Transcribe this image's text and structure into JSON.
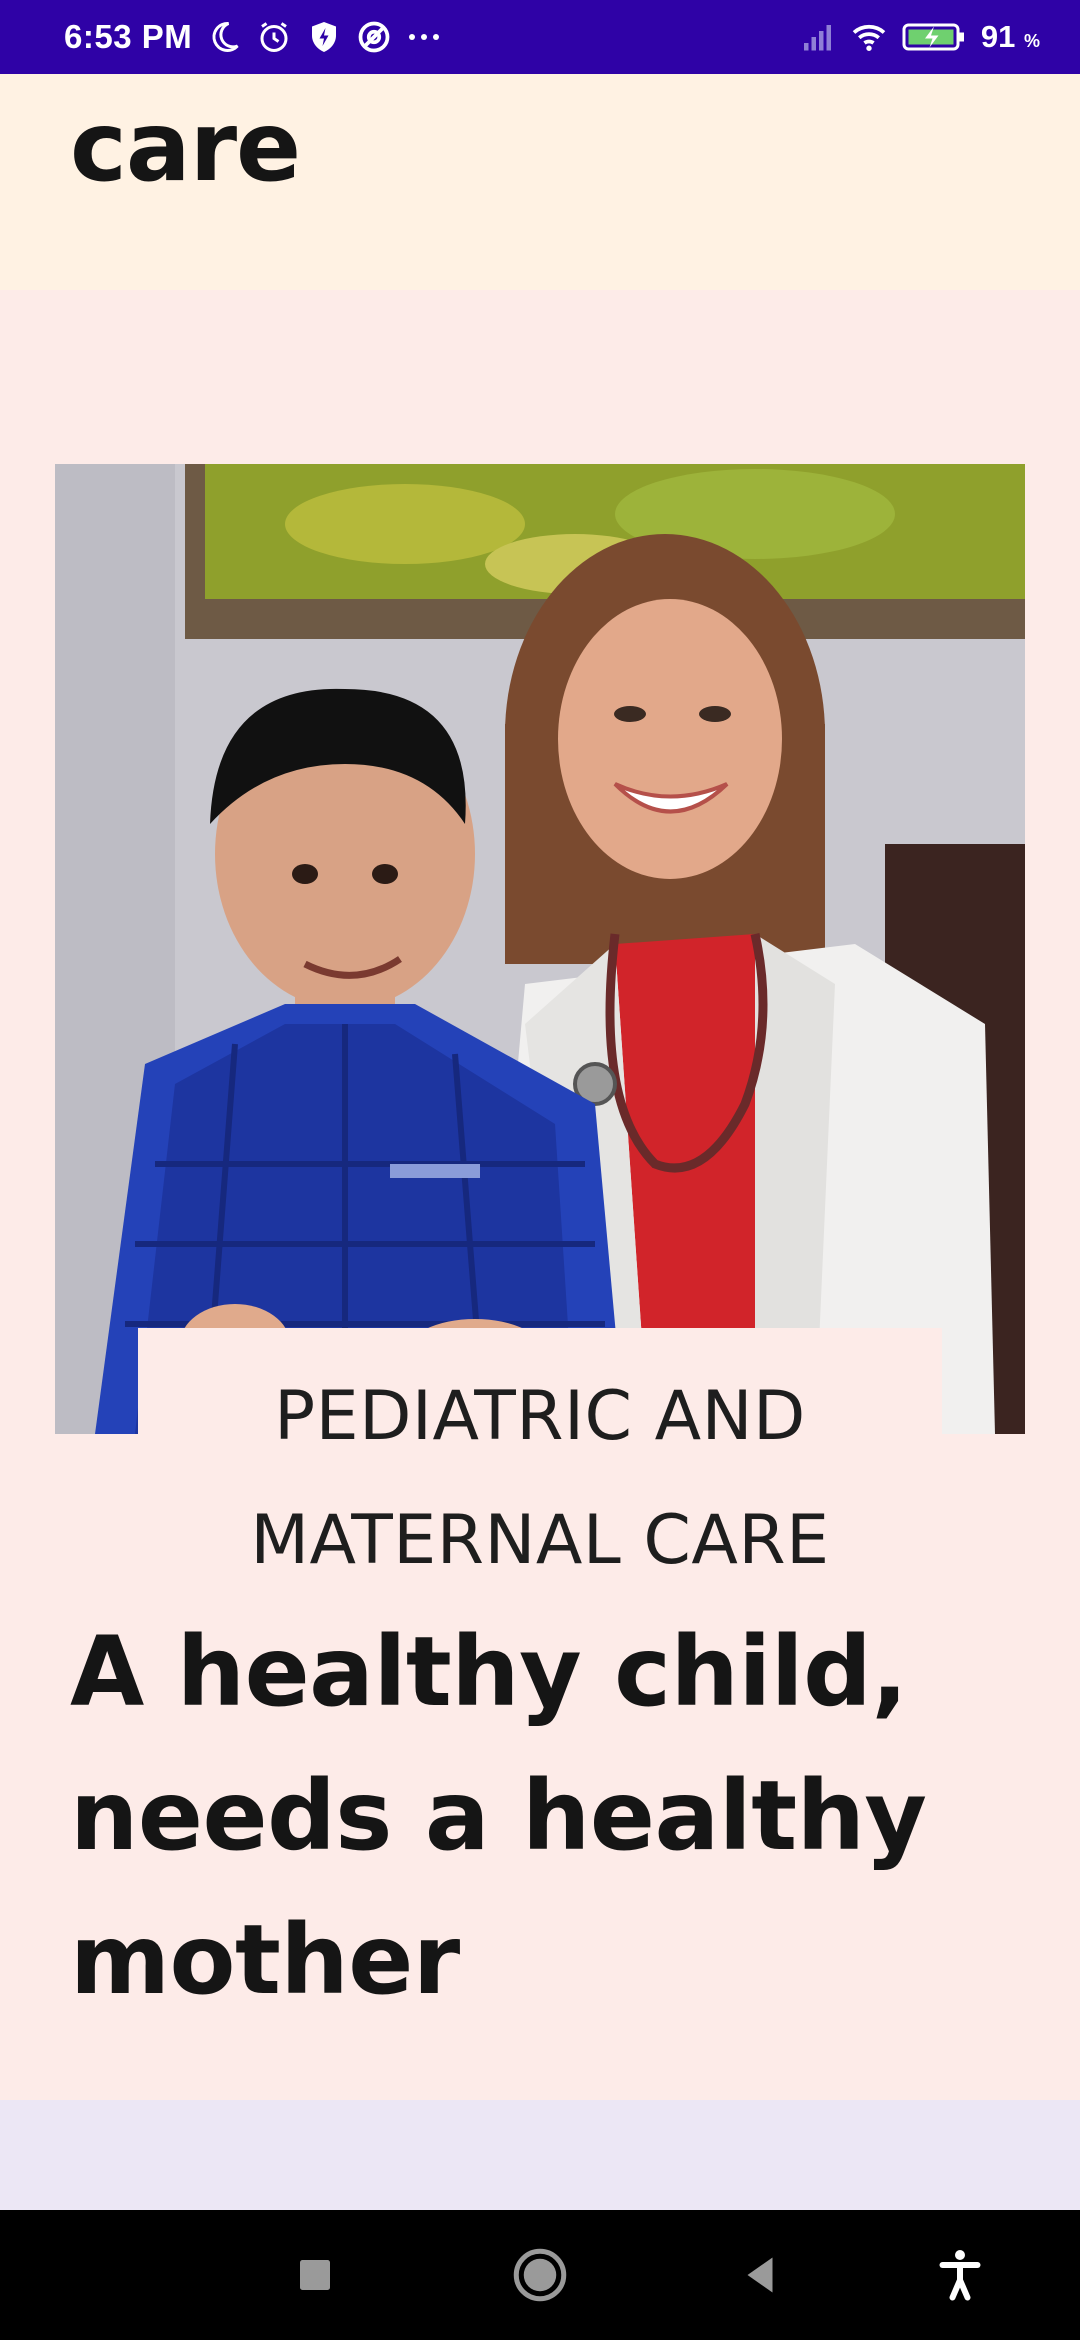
{
  "status_bar": {
    "time": "6:53 PM",
    "icons_left": [
      "moon-icon",
      "alarm-icon",
      "shield-icon",
      "at-icon",
      "more-dots-icon"
    ],
    "icons_right": [
      "signal-icon",
      "wifi-icon",
      "battery-charging-icon"
    ],
    "battery_percent": "91",
    "battery_unit": "%"
  },
  "top_section": {
    "heading": "care"
  },
  "hero": {
    "photo_alt": "Doctor with child",
    "caption_line1": "PEDIATRIC AND",
    "caption_line2": "MATERNAL CARE",
    "tagline_line1": "A healthy child,",
    "tagline_line2": "needs a healthy",
    "tagline_line3": "mother"
  },
  "nav_bar": {
    "buttons": [
      "recents-square-icon",
      "home-circle-icon",
      "back-triangle-icon",
      "accessibility-icon"
    ]
  },
  "colors": {
    "status_bar": "#2f02a6",
    "top_bg": "#fff2e3",
    "main_bg": "#fdebe8",
    "strip_bg": "#ece7f5",
    "text": "#151515"
  }
}
